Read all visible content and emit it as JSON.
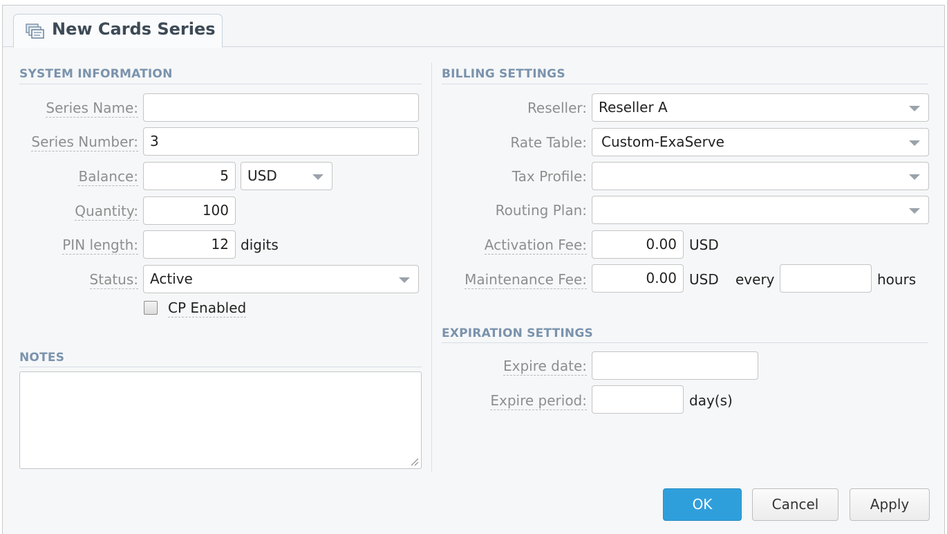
{
  "tab": {
    "title": "New Cards Series",
    "icon": "cards-series-icon"
  },
  "system": {
    "title": "SYSTEM INFORMATION",
    "series_name_label": "Series Name:",
    "series_name_value": "",
    "series_number_label": "Series Number:",
    "series_number_value": "3",
    "balance_label": "Balance:",
    "balance_value": "5",
    "currency_value": "USD",
    "quantity_label": "Quantity:",
    "quantity_value": "100",
    "pin_length_label": "PIN length:",
    "pin_length_value": "12",
    "pin_unit": "digits",
    "status_label": "Status:",
    "status_value": "Active",
    "cp_enabled_label": "CP Enabled",
    "cp_enabled_checked": false
  },
  "notes": {
    "title": "NOTES",
    "value": ""
  },
  "billing": {
    "title": "BILLING SETTINGS",
    "reseller_label": "Reseller:",
    "reseller_value": "Reseller A",
    "rate_table_label": "Rate Table:",
    "rate_table_value": "Custom-ExaServe",
    "tax_profile_label": "Tax Profile:",
    "tax_profile_value": "",
    "routing_plan_label": "Routing Plan:",
    "routing_plan_value": "",
    "activation_fee_label": "Activation Fee:",
    "activation_fee_value": "0.00",
    "activation_fee_currency": "USD",
    "maintenance_fee_label": "Maintenance Fee:",
    "maintenance_fee_value": "0.00",
    "maintenance_fee_currency": "USD",
    "every_label": "every",
    "hours_value": "",
    "hours_label": "hours"
  },
  "expiration": {
    "title": "EXPIRATION SETTINGS",
    "expire_date_label": "Expire date:",
    "expire_date_value": "",
    "expire_period_label": "Expire period:",
    "expire_period_value": "",
    "expire_period_unit": "day(s)"
  },
  "buttons": {
    "ok": "OK",
    "cancel": "Cancel",
    "apply": "Apply"
  },
  "colors": {
    "primary_button": "#2f9fdc",
    "section_title": "#7a93ad"
  }
}
